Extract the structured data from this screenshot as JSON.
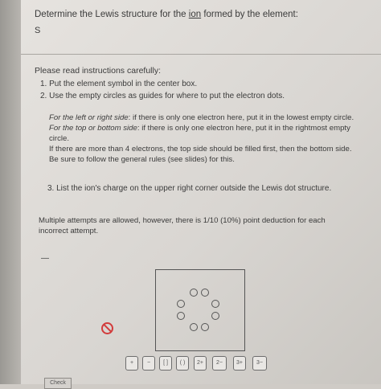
{
  "question": {
    "prefix": "Determine the Lewis structure for the",
    "ion_word": "ion",
    "suffix": "formed by the element:",
    "element": "S"
  },
  "instructions": {
    "heading": "Please read instructions carefully:",
    "step1": "1. Put the element symbol in the center box.",
    "step2": "2. Use the empty circles as guides for where to put the electron dots.",
    "note1_label": "For the left or right side",
    "note1_text": ": if there is only one electron here, put it in the lowest empty circle.",
    "note2_label": "For the top or bottom side",
    "note2_text": ": if there is only one electron here, put it in the rightmost empty circle.",
    "note3": "If there are more than 4 electrons, the top side should be filled first, then the bottom side.",
    "note4": "Be sure to follow the general rules (see slides) for this.",
    "step3": "3. List the ion's charge on the upper right corner outside the Lewis dot structure."
  },
  "attempts_text": "Multiple attempts are allowed, however, there is 1/10 (10%) point deduction for each incorrect attempt.",
  "dash": "—",
  "toolbar": {
    "tools": [
      "+",
      "−",
      "[ ]",
      "( )",
      "2+",
      "2−",
      "3+",
      "3−"
    ]
  },
  "check_label": "Check",
  "colors": {
    "clear_icon": "#d23b3b"
  }
}
